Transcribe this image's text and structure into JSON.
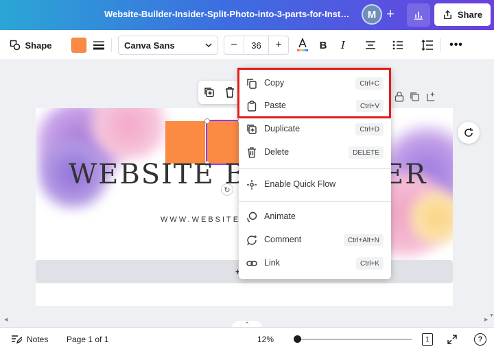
{
  "header": {
    "doc_title": "Website-Builder-Insider-Split-Photo-into-3-parts-for-Instag...",
    "avatar_initial": "M",
    "share_label": "Share"
  },
  "toolbar": {
    "shape_label": "Shape",
    "shape_color": "#fb8a43",
    "font_name": "Canva Sans",
    "font_size": "36",
    "minus": "−",
    "plus": "+"
  },
  "canvas": {
    "title_text": "WEBSITE BUI",
    "title_tail": "ER",
    "subtitle_text": "WWW.WEBSITEBU",
    "add_page_label": "+ Ad"
  },
  "context_menu": {
    "items": [
      {
        "label": "Copy",
        "shortcut": "Ctrl+C",
        "icon": "copy-icon"
      },
      {
        "label": "Paste",
        "shortcut": "Ctrl+V",
        "icon": "paste-icon"
      },
      {
        "label": "Duplicate",
        "shortcut": "Ctrl+D",
        "icon": "duplicate-icon"
      },
      {
        "label": "Delete",
        "shortcut": "DELETE",
        "icon": "trash-icon"
      },
      {
        "label": "Enable Quick Flow",
        "shortcut": "",
        "icon": "quick-flow-icon"
      },
      {
        "label": "Animate",
        "shortcut": "",
        "icon": "animate-icon"
      },
      {
        "label": "Comment",
        "shortcut": "Ctrl+Alt+N",
        "icon": "comment-icon"
      },
      {
        "label": "Link",
        "shortcut": "Ctrl+K",
        "icon": "link-icon"
      }
    ],
    "highlight_color": "#e21b1b"
  },
  "footer": {
    "notes_label": "Notes",
    "page_indicator": "Page 1 of 1",
    "zoom_level": "12%",
    "page_count_badge": "1"
  }
}
